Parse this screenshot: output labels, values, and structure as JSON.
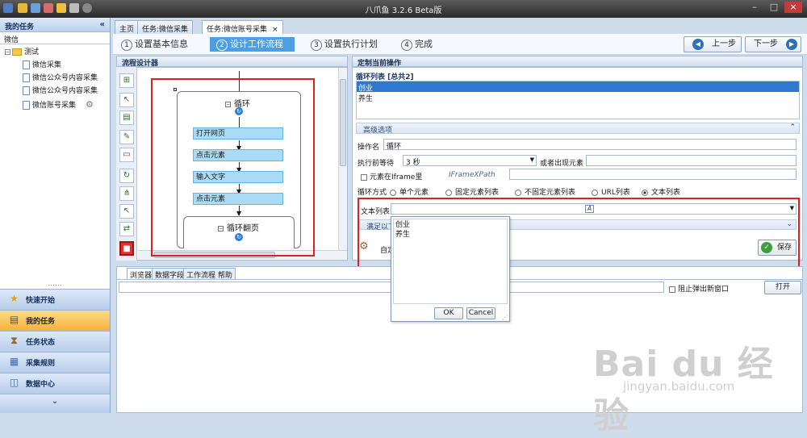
{
  "window": {
    "title": "八爪鱼 3.2.6 Beta版"
  },
  "sidebar": {
    "header": "我的任务",
    "collapse_icon": "«",
    "search_value": "微信",
    "tree": {
      "root": "测试",
      "items": [
        "微信采集",
        "微信公众号内容采集",
        "微信公众号内容采集",
        "微信账号采集"
      ]
    },
    "grip": "......",
    "nav": [
      {
        "label": "快速开始",
        "icon": "star-icon"
      },
      {
        "label": "我的任务",
        "icon": "task-icon",
        "selected": true
      },
      {
        "label": "任务状态",
        "icon": "hourglass-icon"
      },
      {
        "label": "采集规则",
        "icon": "rule-icon"
      },
      {
        "label": "数据中心",
        "icon": "database-icon"
      }
    ],
    "more": "⌄"
  },
  "tabs": [
    {
      "label": "主页"
    },
    {
      "label": "任务:微信采集"
    },
    {
      "label": "任务:微信账号采集",
      "active": true,
      "close": "×"
    }
  ],
  "steps": [
    {
      "num": "1",
      "label": "设置基本信息"
    },
    {
      "num": "2",
      "label": "设计工作流程",
      "active": true
    },
    {
      "num": "3",
      "label": "设置执行计划"
    },
    {
      "num": "4",
      "label": "完成"
    }
  ],
  "nav_buttons": {
    "prev": "上一步",
    "next": "下一步"
  },
  "designer": {
    "title": "流程设计器",
    "loop_title": "循环",
    "nodes": [
      "打开网页",
      "点击元素",
      "输入文字",
      "点击元素"
    ],
    "inner_loop_title": "循环翻页"
  },
  "right_panel": {
    "title": "定制当前操作",
    "loop_list_title": "循环列表 [总共2]",
    "loop_list": [
      "创业",
      "养生"
    ],
    "advanced_title": "高级选项",
    "op_name_label": "操作名",
    "op_name_value": "循环",
    "wait_label": "执行前等待",
    "wait_value": "3 秒",
    "or_appear_label": "或者出现元素",
    "iframe_label": "元素在Iframe里",
    "iframe_xpath_label": "IFrameXPath",
    "loop_mode_label": "循环方式",
    "loop_modes": [
      "单个元素",
      "固定元素列表",
      "不固定元素列表",
      "URL列表",
      "文本列表"
    ],
    "loop_mode_selected": "文本列表",
    "text_list_label": "文本列表",
    "text_list_edit_icon": "A",
    "condition_label": "满足以下",
    "custom_label": "自定",
    "save_label": "保存"
  },
  "dropdown": {
    "lines": [
      "创业",
      "养生"
    ],
    "ok": "OK",
    "cancel": "Cancel"
  },
  "bottom": {
    "tabs": [
      "浏览器",
      "数据字段",
      "工作流程 帮助"
    ],
    "block_popup_label": "阻止弹出新窗口",
    "open_label": "打开"
  },
  "watermark": {
    "brand": "Bai du 经验",
    "url": "jingyan.baidu.com"
  },
  "colors": {
    "accent": "#4d9ee4",
    "highlight": "#e02020",
    "node": "#a9dcf4",
    "nav_selected": "#f5b13a"
  }
}
